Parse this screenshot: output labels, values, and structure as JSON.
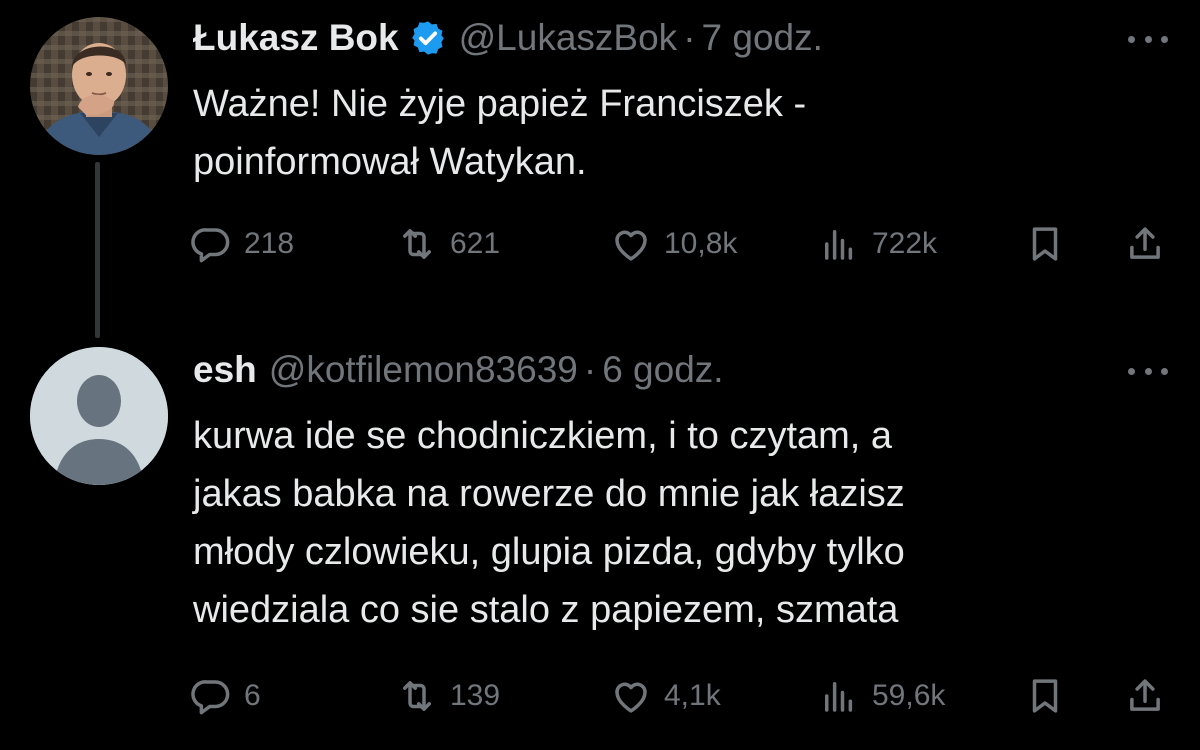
{
  "tweets": [
    {
      "author": {
        "display_name": "Łukasz Bok",
        "verified": true,
        "handle": "@LukaszBok",
        "avatar_icon": "profile-photo-man"
      },
      "separator": "·",
      "time": "7 godz.",
      "text": "Ważne! Nie żyje papież Franciszek -\npoinformował Watykan.",
      "stats": {
        "replies": "218",
        "retweets": "621",
        "likes": "10,8k",
        "views": "722k"
      }
    },
    {
      "author": {
        "display_name": "esh",
        "verified": false,
        "handle": "@kotfilemon83639",
        "avatar_icon": "default-avatar-icon"
      },
      "separator": "·",
      "time": "6 godz.",
      "text": "kurwa ide se chodniczkiem, i to czytam, a\njakas babka na rowerze do mnie jak łazisz\nmłody czlowieku, glupia pizda, gdyby tylko\nwiedziala co sie stalo z papiezem, szmata",
      "stats": {
        "replies": "6",
        "retweets": "139",
        "likes": "4,1k",
        "views": "59,6k"
      }
    }
  ],
  "colors": {
    "background": "#000000",
    "text_primary": "#e7e9ea",
    "text_secondary": "#71767b",
    "verified_badge": "#1d9bf0",
    "thread_line": "#333639",
    "default_avatar_bg": "#cfd9de",
    "default_avatar_fg": "#67747f"
  },
  "icons": [
    "reply-icon",
    "retweet-icon",
    "like-icon",
    "views-icon",
    "bookmark-icon",
    "share-icon",
    "more-icon",
    "verified-badge-icon"
  ]
}
